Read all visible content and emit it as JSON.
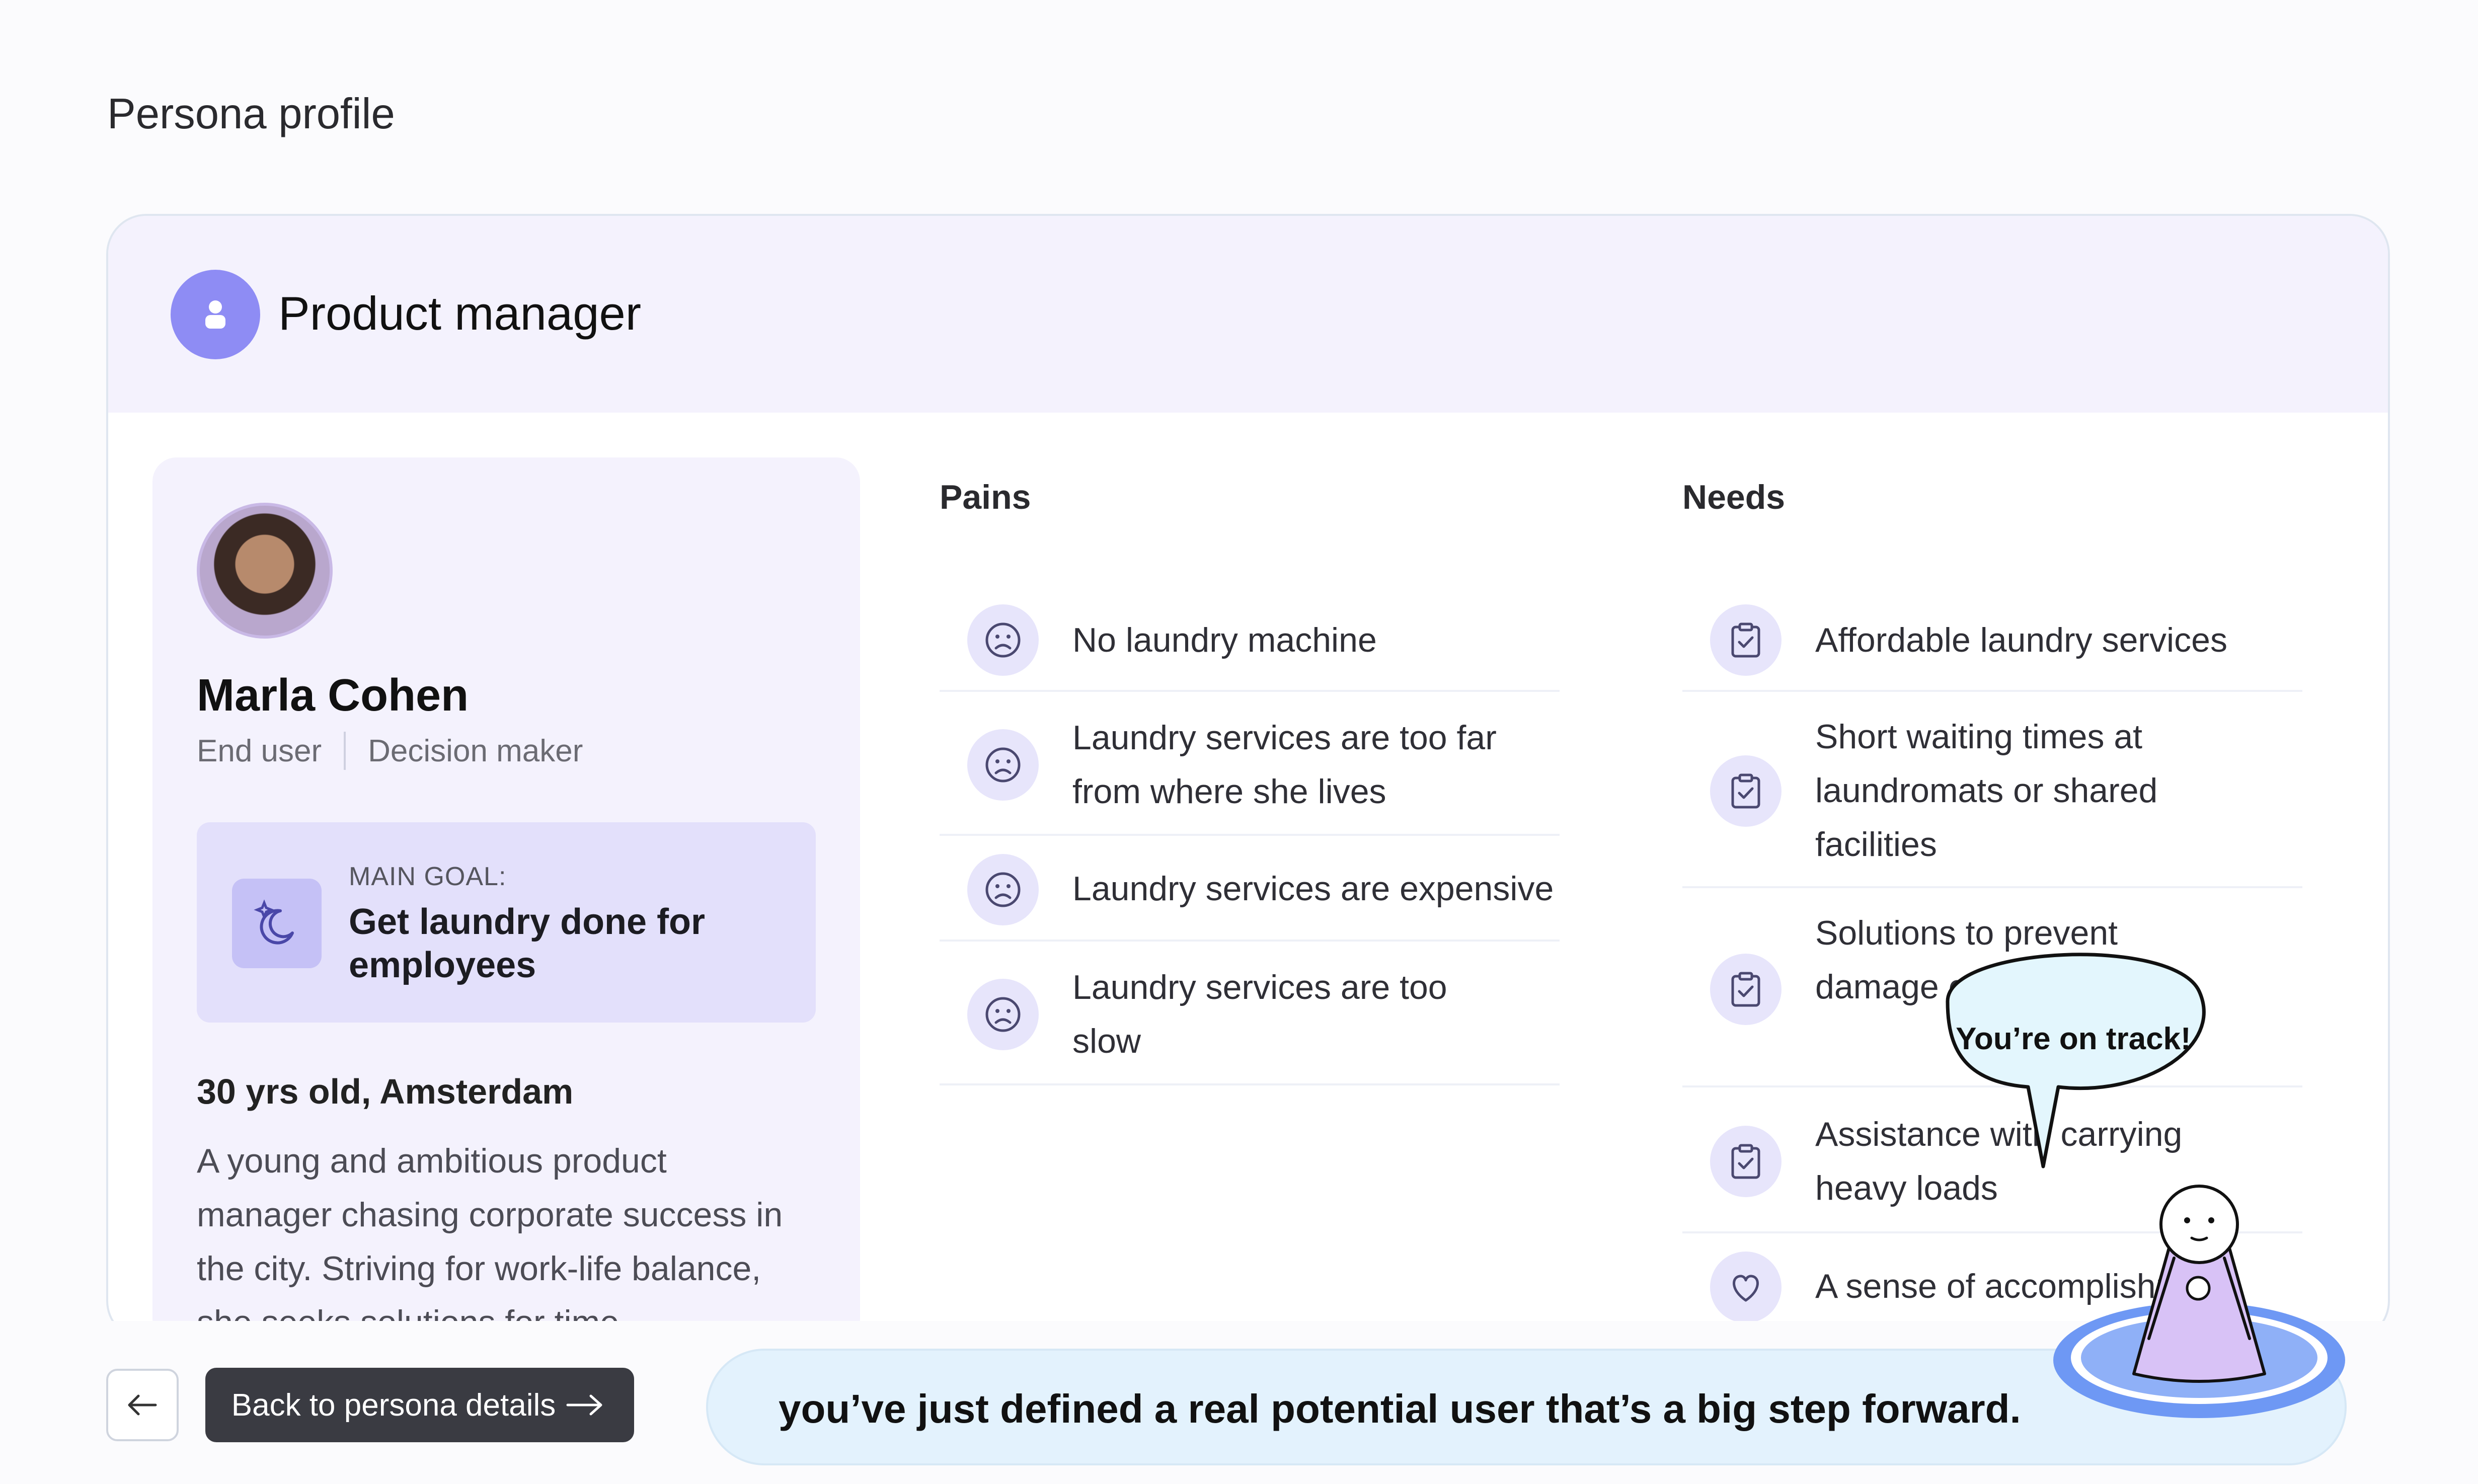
{
  "page": {
    "title": "Persona profile"
  },
  "persona": {
    "role": "Product manager",
    "name": "Marla Cohen",
    "tags": [
      "End user",
      "Decision maker"
    ],
    "main_goal_label": "MAIN GOAL:",
    "main_goal": "Get laundry done for employees",
    "age_location": "30 yrs old, Amsterdam",
    "bio": "A young and ambitious product manager chasing corporate success in the city. Striving for work-life balance, she seeks solutions for time"
  },
  "pains": {
    "title": "Pains",
    "items": [
      {
        "text": "No laundry machine",
        "icon": "frown-icon"
      },
      {
        "text": "Laundry services are too far from where she lives",
        "icon": "frown-icon"
      },
      {
        "text": "Laundry services are expensive",
        "icon": "frown-icon"
      },
      {
        "text": "Laundry services are too slow",
        "icon": "frown-icon"
      }
    ]
  },
  "needs": {
    "title": "Needs",
    "items": [
      {
        "text": "Affordable laundry services",
        "icon": "clipboard-check-icon"
      },
      {
        "text": "Short waiting times at laundromats or shared facilities",
        "icon": "clipboard-check-icon"
      },
      {
        "text": "Solutions to prevent damage of clothes",
        "icon": "clipboard-check-icon"
      },
      {
        "text": "Assistance with carrying heavy loads",
        "icon": "clipboard-check-icon"
      },
      {
        "text": "A sense of accomplishment",
        "icon": "heart-icon"
      }
    ]
  },
  "mascot": {
    "speech": "You’re on track!"
  },
  "footer": {
    "back_label": "Back to persona details",
    "banner": "you’ve just defined a real potential user that’s a big step forward."
  },
  "colors": {
    "accent": "#8e8cf4",
    "header_bg": "#f4f2fd",
    "goal_bg": "#e3e0fb",
    "banner_bg": "#e3f2fd",
    "button_dark": "#3a3b42"
  }
}
